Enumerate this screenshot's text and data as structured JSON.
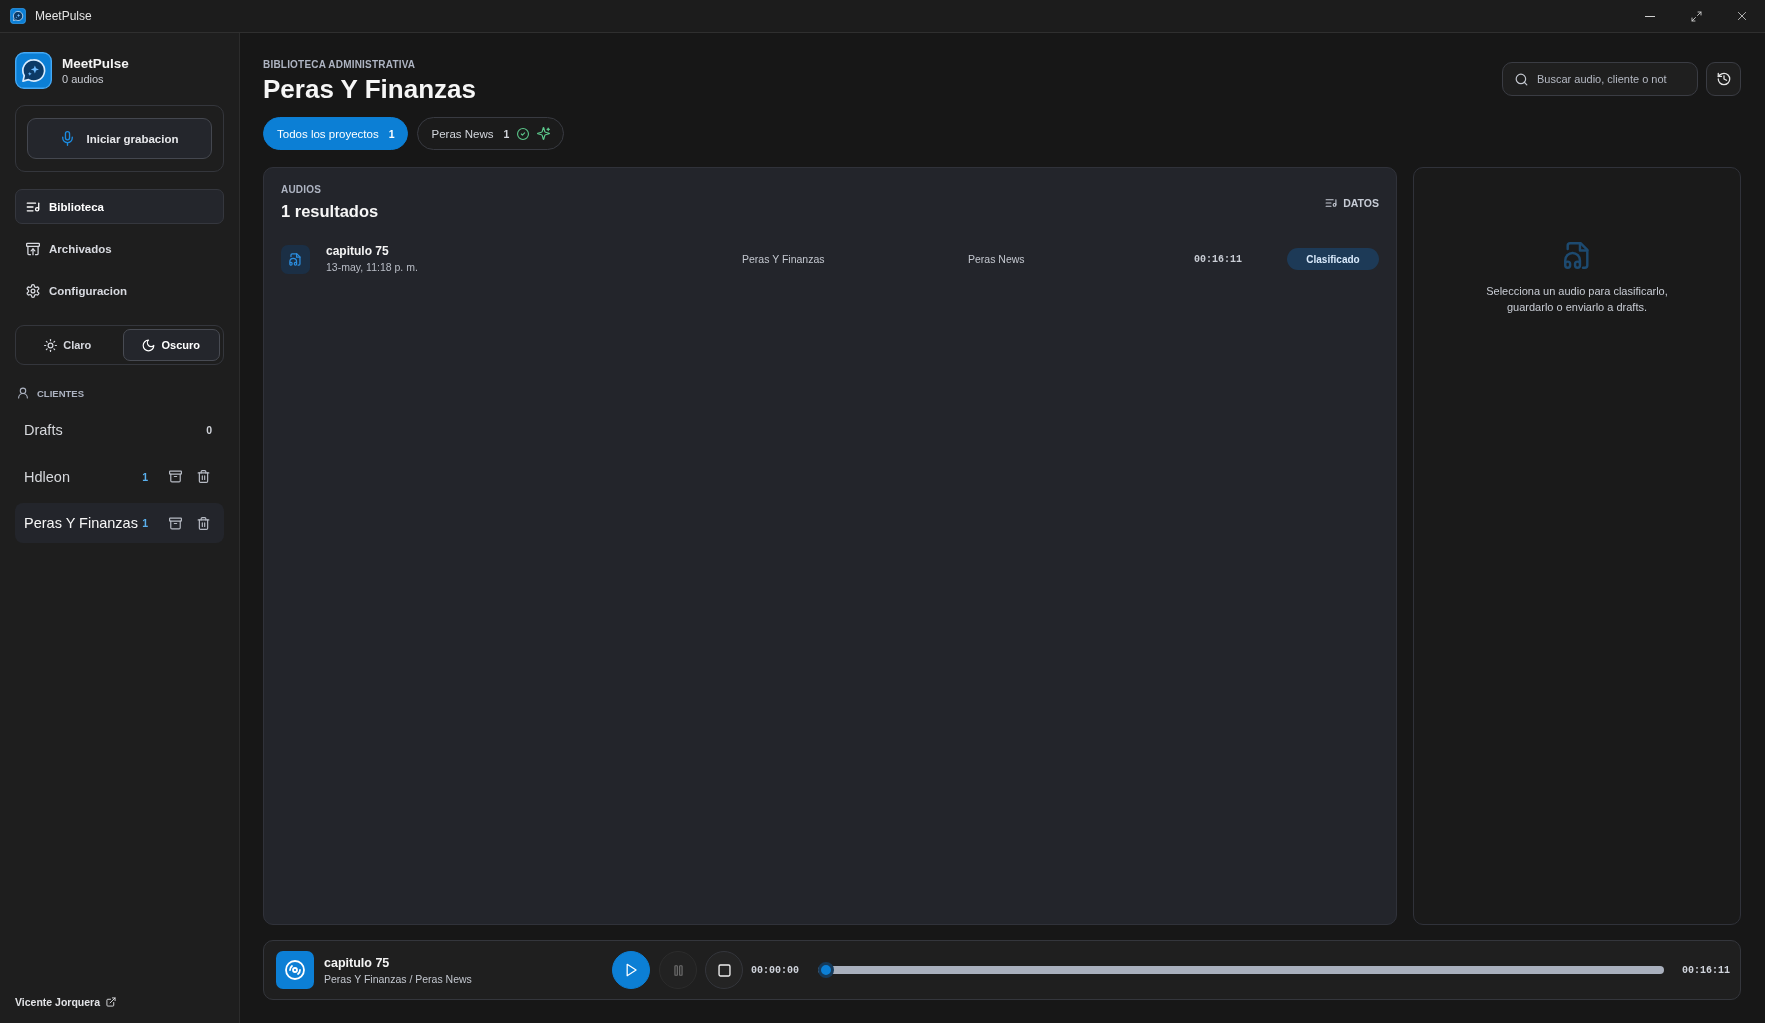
{
  "window": {
    "title": "MeetPulse"
  },
  "sidebar": {
    "brand": {
      "name": "MeetPulse",
      "subtitle": "0 audios"
    },
    "record_button": "Iniciar grabacion",
    "nav": [
      {
        "label": "Biblioteca",
        "selected": true
      },
      {
        "label": "Archivados",
        "selected": false
      },
      {
        "label": "Configuracion",
        "selected": false
      }
    ],
    "theme": [
      {
        "label": "Claro",
        "selected": false
      },
      {
        "label": "Oscuro",
        "selected": true
      }
    ],
    "clients_heading": "CLIENTES",
    "clients": [
      {
        "name": "Drafts",
        "count": "0",
        "kind": "drafts",
        "selected": false
      },
      {
        "name": "Hdleon",
        "count": "1",
        "kind": "client",
        "selected": false
      },
      {
        "name": "Peras Y Finanzas",
        "count": "1",
        "kind": "client",
        "selected": true
      }
    ],
    "user_link": "Vicente Jorquera"
  },
  "header": {
    "eyebrow": "BIBLIOTECA ADMINISTRATIVA",
    "title": "Peras Y Finanzas",
    "search": {
      "placeholder": "Buscar audio, cliente o not"
    }
  },
  "tabs": [
    {
      "label": "Todos los proyectos",
      "count": "1",
      "kind": "all",
      "selected": true
    },
    {
      "label": "Peras News",
      "count": "1",
      "kind": "project",
      "selected": false
    }
  ],
  "audios": {
    "eyebrow": "AUDIOS",
    "count_label": "1 resultados",
    "data_button": "DATOS",
    "rows": [
      {
        "title": "capitulo 75",
        "date": "13-may, 11:18 p. m.",
        "client": "Peras Y Finanzas",
        "project": "Peras News",
        "duration": "00:16:11",
        "status": "Clasificado"
      }
    ]
  },
  "details": {
    "empty_message": "Selecciona un audio para clasificarlo, guardarlo o enviarlo a drafts."
  },
  "player": {
    "title": "capitulo 75",
    "subtitle": "Peras Y Finanzas / Peras News",
    "playing": false,
    "elapsed": "00:00:00",
    "level": 0,
    "total": "00:16:11"
  }
}
